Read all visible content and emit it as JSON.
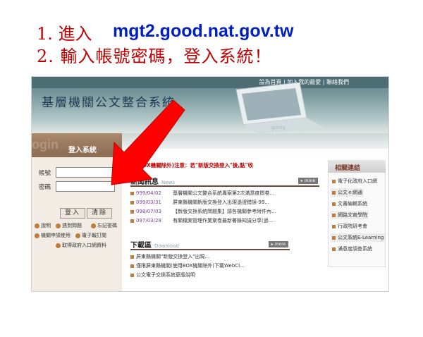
{
  "instructions": {
    "step1": "1. 進入",
    "url": "mgt2.good.nat.gov.tw",
    "step2": "2. 輸入帳號密碼，登入系統！"
  },
  "site": {
    "top_links": "設為首頁 | 加入我的最愛 | 聯絡我們",
    "title": "基層機關公文整合系統",
    "banner_text": "gurey"
  },
  "login": {
    "deco": "ogin",
    "title": "登入系統",
    "account_label": "帳號",
    "password_label": "密碼",
    "login_button": "登入",
    "clear_button": "清除",
    "links": [
      "說明",
      "遇到問題",
      "忘記密碼",
      "機關申請使用",
      "電子報訂閱",
      "取得政府入口網資料"
    ]
  },
  "notice": "使用BOX機關除外)注意：若\"新版交換登入\"後,點\"收",
  "news": {
    "title": "新聞訊息",
    "subtitle": "News",
    "more": "more",
    "items": [
      {
        "date": "099/04/02",
        "title": "基層機關公文整合系統專案第2次滿意度問卷..."
      },
      {
        "date": "099/03/31",
        "title": "屏東縣機關新版交換登入出現憑證錯誤-99..."
      },
      {
        "date": "098/07/03",
        "title": "【新版交換系統問題集】請各機關參考附件內..."
      },
      {
        "date": "097/03/28",
        "title": "有關檔案管理作業案卷最新著錄知識分享(過..."
      }
    ]
  },
  "downloads": {
    "title": "下載區",
    "subtitle": "Download",
    "more": "more",
    "items": [
      "屏東縣機關\"新版交換登入\"出現...",
      "僅限屏東縣機關(使用BOX機關除外)下載WebCl...",
      "公文電子交換系統更版說明"
    ]
  },
  "related": {
    "title": "相關連結",
    "links": [
      "電子化政府入口網",
      "公文ｅ網通",
      "文書編輯系統",
      "網路文官學院",
      "行政院研考會",
      "公文系統E-Learning",
      "滿意度調查系統"
    ]
  }
}
